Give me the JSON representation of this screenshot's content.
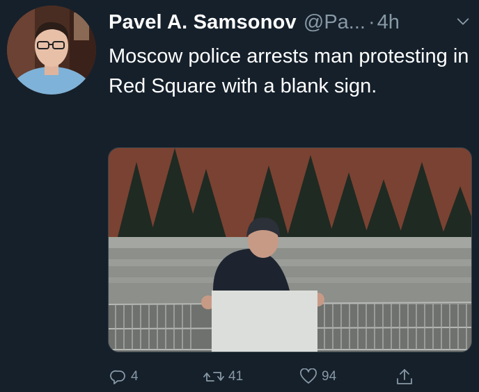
{
  "tweet": {
    "author_name": "Pavel A. Samsonov",
    "handle": "@Pa...",
    "separator": "·",
    "time": "4h",
    "text": "Moscow police arrests man protesting in Red Square with a blank sign.",
    "avatar_icon": "user-avatar-photo",
    "media_icon": "protest-photo"
  },
  "actions": {
    "reply_count": "4",
    "retweet_count": "41",
    "like_count": "94"
  },
  "colors": {
    "background": "#15202b",
    "secondary_text": "#8899a6",
    "primary_text": "#ffffff"
  }
}
